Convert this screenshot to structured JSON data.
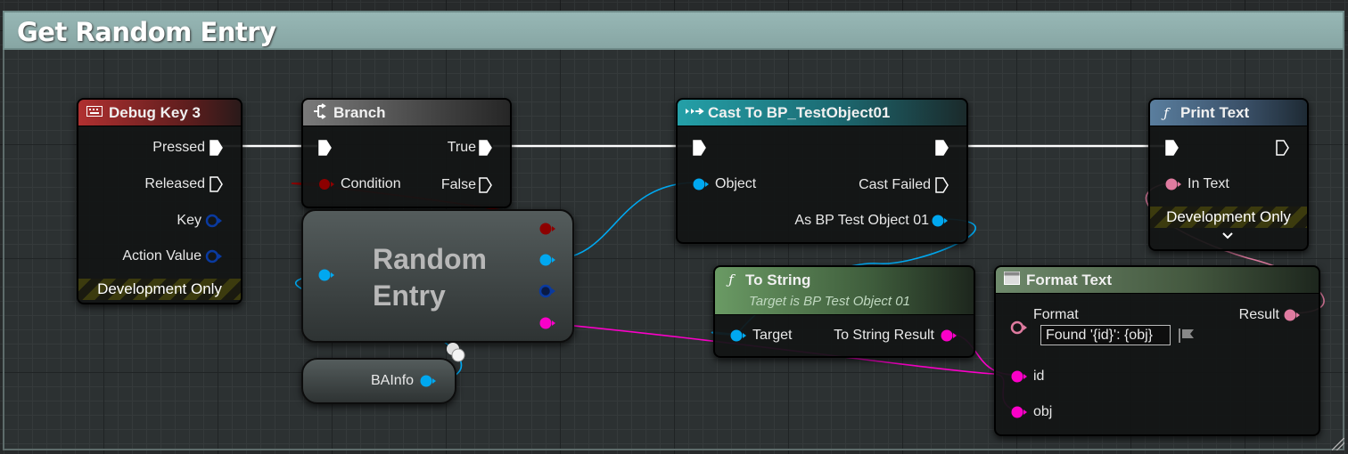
{
  "comment": {
    "title": "Get Random Entry"
  },
  "nodes": {
    "debug_key": {
      "title": "Debug Key 3",
      "pins": [
        "Pressed",
        "Released",
        "Key",
        "Action Value"
      ],
      "footer": "Development Only"
    },
    "branch": {
      "title": "Branch",
      "inputs": [
        "Condition"
      ],
      "outputs": [
        "True",
        "False"
      ]
    },
    "random_entry": {
      "title": "Random Entry"
    },
    "bainfo": {
      "label": "BAInfo"
    },
    "cast": {
      "title": "Cast To BP_TestObject01",
      "inputs": [
        "Object"
      ],
      "outputs": [
        "Cast Failed",
        "As BP Test Object 01"
      ]
    },
    "to_string": {
      "title": "To String",
      "subtitle": "Target is BP Test Object 01",
      "inputs": [
        "Target"
      ],
      "outputs": [
        "To String Result"
      ]
    },
    "print_text": {
      "title": "Print Text",
      "inputs": [
        "In Text"
      ],
      "footer": "Development Only"
    },
    "format_text": {
      "title": "Format Text",
      "inputs": [
        "Format",
        "id",
        "obj"
      ],
      "outputs": [
        "Result"
      ],
      "format_value": "Found '{id}': {obj}"
    }
  },
  "colors": {
    "exec": "#ffffff",
    "bool": "#8c0000",
    "object": "#00a8f0",
    "struct": "#0a3aa0",
    "string": "#fa00c8",
    "text": "#e07ba0",
    "header_red": "#8a2020",
    "header_gray": "#6b6b6b",
    "header_teal": "#1c7a84",
    "header_green": "#4e7a4a",
    "header_blue": "#4a6f8a"
  }
}
